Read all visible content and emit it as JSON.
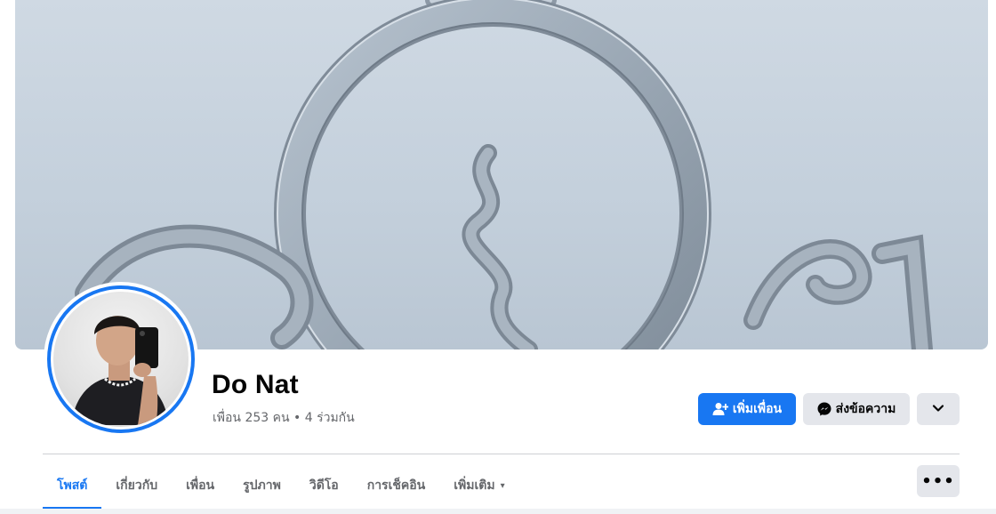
{
  "profile": {
    "name": "Do Nat",
    "friends_summary": "เพื่อน 253 คน • 4 ร่วมกัน"
  },
  "actions": {
    "add_friend_label": "เพิ่มเพื่อน",
    "message_label": "ส่งข้อความ",
    "add_friend_icon": "add-person-icon",
    "message_icon": "messenger-icon",
    "more_icon": "chevron-down-icon"
  },
  "tabs": [
    {
      "label": "โพสต์",
      "active": true
    },
    {
      "label": "เกี่ยวกับ",
      "active": false
    },
    {
      "label": "เพื่อน",
      "active": false
    },
    {
      "label": "รูปภาพ",
      "active": false
    },
    {
      "label": "วิดีโอ",
      "active": false
    },
    {
      "label": "การเช็คอิน",
      "active": false
    },
    {
      "label": "เพิ่มเติม",
      "active": false
    }
  ],
  "tab_more_caret": "▾",
  "tab_overflow_glyph": "•••",
  "colors": {
    "accent": "#1877f2",
    "secondary_button": "#e4e6eb",
    "muted_text": "#65676b"
  }
}
